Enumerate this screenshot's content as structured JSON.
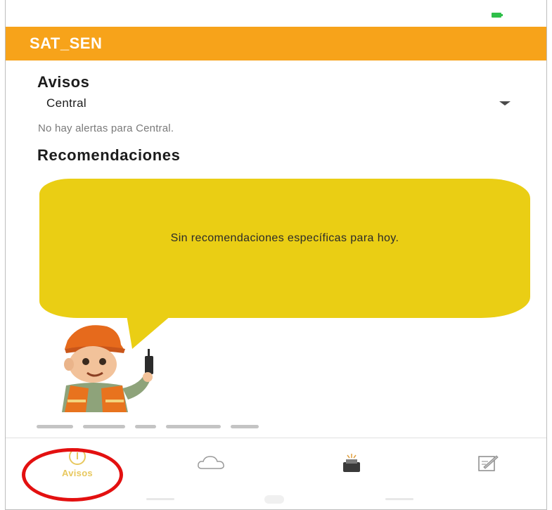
{
  "app": {
    "title": "SAT_SEN"
  },
  "alerts": {
    "heading": "Avisos",
    "selected_region": "Central",
    "empty_message": "No hay alertas para Central."
  },
  "recommendations": {
    "heading": "Recomendaciones",
    "message": "Sin recomendaciones específicas para hoy."
  },
  "bottom_nav": {
    "items": [
      {
        "label": "Avisos",
        "icon": "alert-circle-icon",
        "active": true
      },
      {
        "label": "",
        "icon": "cloud-icon",
        "active": false
      },
      {
        "label": "",
        "icon": "radio-report-icon",
        "active": false
      },
      {
        "label": "",
        "icon": "survey-edit-icon",
        "active": false
      }
    ]
  },
  "colors": {
    "app_bar": "#f7a31a",
    "bubble": "#eace14",
    "active_nav": "#e8c85e",
    "highlight": "#e31010"
  }
}
